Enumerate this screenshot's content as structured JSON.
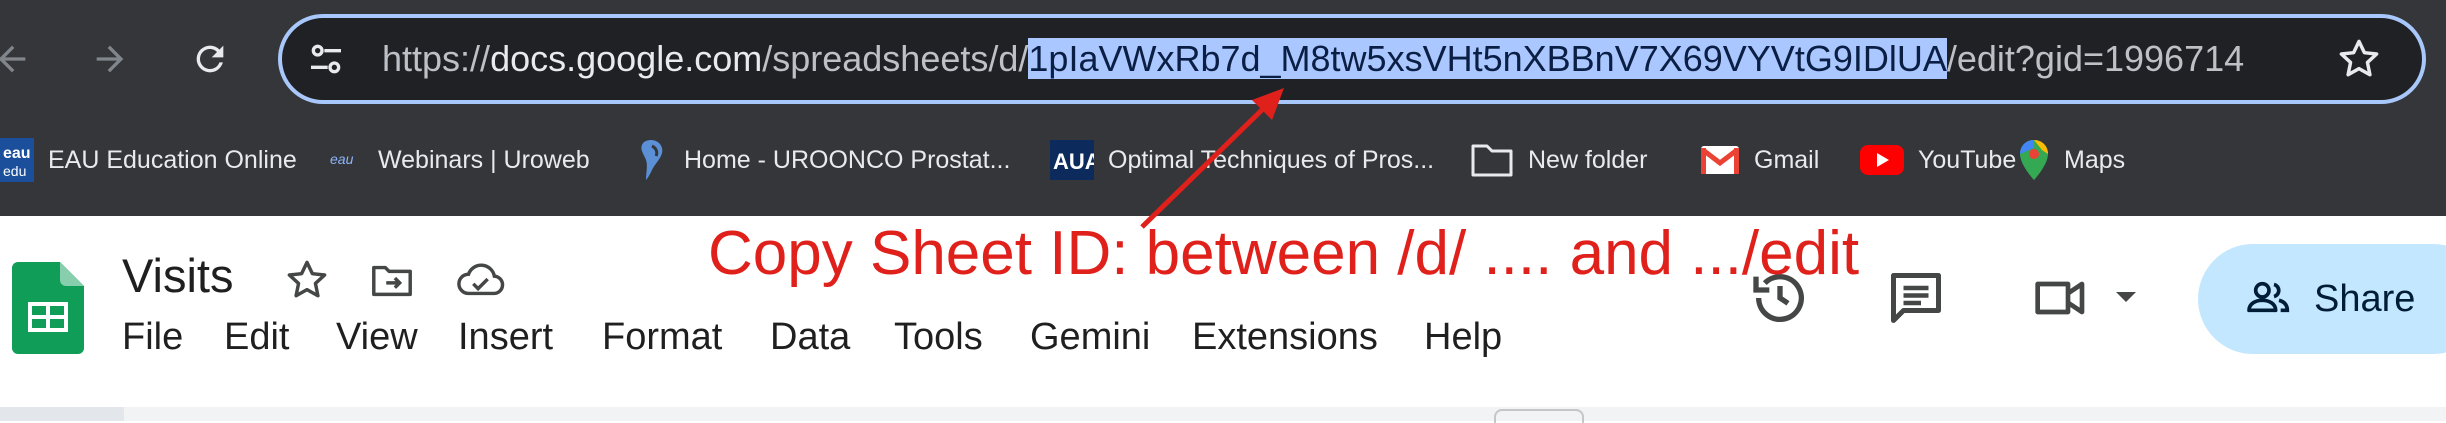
{
  "browser": {
    "url": {
      "prefix": "https://",
      "host": "docs.google.com",
      "path_before": "/spreadsheets/d/",
      "sheet_id": "1pIaVWxRb7d_M8tw5xsVHt5nXBBnV7X69VYVtG9IDlUA",
      "path_after": "/edit?gid=1996714"
    },
    "bookmarks": [
      {
        "label": "EAU Education Online",
        "icon": "eau-logo-icon"
      },
      {
        "label": "Webinars | Uroweb",
        "icon": "eau-small-icon"
      },
      {
        "label": "Home - UROONCO Prostat...",
        "icon": "ribbon-icon"
      },
      {
        "label": "Optimal Techniques of Pros...",
        "icon": "aua-logo-icon"
      },
      {
        "label": "New folder",
        "icon": "folder-icon"
      },
      {
        "label": "Gmail",
        "icon": "gmail-icon"
      },
      {
        "label": "YouTube",
        "icon": "youtube-icon"
      },
      {
        "label": "Maps",
        "icon": "maps-icon"
      }
    ],
    "colors": {
      "chrome_bg": "#35363a",
      "omnibox_border": "#a8c7fa",
      "selection": "#aac7ff"
    }
  },
  "sheets": {
    "doc_title": "Visits",
    "menu": [
      "File",
      "Edit",
      "View",
      "Insert",
      "Format",
      "Data",
      "Tools",
      "Gemini",
      "Extensions",
      "Help"
    ],
    "share_label": "Share",
    "colors": {
      "share_bg": "#c2e7ff",
      "logo_green": "#0f9d58"
    }
  },
  "annotation": {
    "text": "Copy Sheet ID: between /d/ .... and .../edit",
    "color": "#e0201b"
  }
}
